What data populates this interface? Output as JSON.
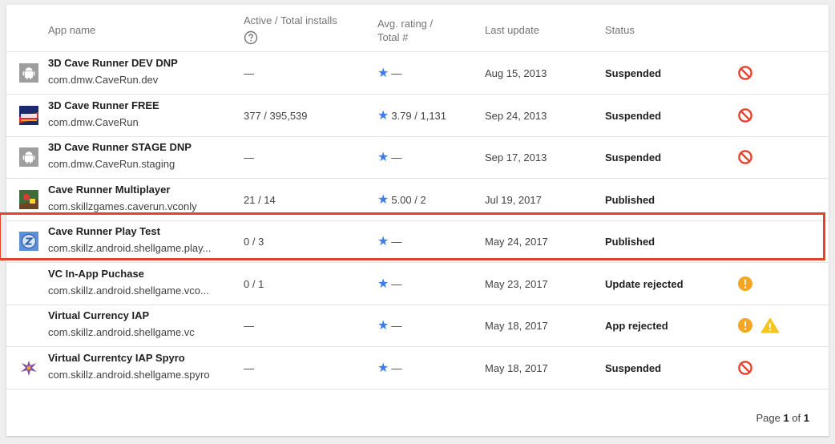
{
  "header": {
    "app_name": "App name",
    "installs": "Active / Total installs",
    "rating_line1": "Avg. rating /",
    "rating_line2": "Total #",
    "last_update": "Last update",
    "status": "Status"
  },
  "colors": {
    "suspended_red": "#e5422b",
    "warning_orange": "#f5a623",
    "warning_yellow": "#f8c51c",
    "star_blue": "#3f7ee8",
    "highlight": "#e5422b"
  },
  "rows": [
    {
      "name": "3D Cave Runner DEV DNP",
      "package": "com.dmw.CaveRun.dev",
      "installs": "—",
      "rating": "—",
      "updated": "Aug 15, 2013",
      "status": "Suspended",
      "icon": "android-icon",
      "status_icons": [
        "blocked-icon"
      ]
    },
    {
      "name": "3D Cave Runner FREE",
      "package": "com.dmw.CaveRun",
      "installs": "377 / 395,539",
      "rating": "3.79 / 1,131",
      "updated": "Sep 24, 2013",
      "status": "Suspended",
      "icon": "cave-runner-app-icon",
      "status_icons": [
        "blocked-icon"
      ]
    },
    {
      "name": "3D Cave Runner STAGE DNP",
      "package": "com.dmw.CaveRun.staging",
      "installs": "—",
      "rating": "—",
      "updated": "Sep 17, 2013",
      "status": "Suspended",
      "icon": "android-icon",
      "status_icons": [
        "blocked-icon"
      ]
    },
    {
      "name": "Cave Runner Multiplayer",
      "package": "com.skillzgames.caverun.vconly",
      "installs": "21 / 14",
      "rating": "5.00 / 2",
      "updated": "Jul 19, 2017",
      "status": "Published",
      "icon": "multiplayer-app-icon",
      "status_icons": []
    },
    {
      "name": "Cave Runner Play Test",
      "package": "com.skillz.android.shellgame.play...",
      "installs": "0 / 3",
      "rating": "—",
      "updated": "May 24, 2017",
      "status": "Published",
      "icon": "skillz-app-icon",
      "status_icons": []
    },
    {
      "name": "VC In-App Puchase",
      "package": "com.skillz.android.shellgame.vco...",
      "installs": "0 / 1",
      "rating": "—",
      "updated": "May 23, 2017",
      "status": "Update rejected",
      "icon": "none",
      "status_icons": [
        "alert-circle-icon"
      ]
    },
    {
      "name": "Virtual Currency IAP",
      "package": "com.skillz.android.shellgame.vc",
      "installs": "—",
      "rating": "—",
      "updated": "May 18, 2017",
      "status": "App rejected",
      "icon": "none",
      "status_icons": [
        "alert-circle-icon",
        "warning-triangle-icon"
      ]
    },
    {
      "name": "Virtual Currentcy IAP Spyro",
      "package": "com.skillz.android.shellgame.spyro",
      "installs": "—",
      "rating": "—",
      "updated": "May 18, 2017",
      "status": "Suspended",
      "icon": "dragon-app-icon",
      "status_icons": [
        "blocked-icon"
      ]
    }
  ],
  "pagination": {
    "prefix": "Page",
    "current": "1",
    "separator": "of",
    "total": "1"
  }
}
